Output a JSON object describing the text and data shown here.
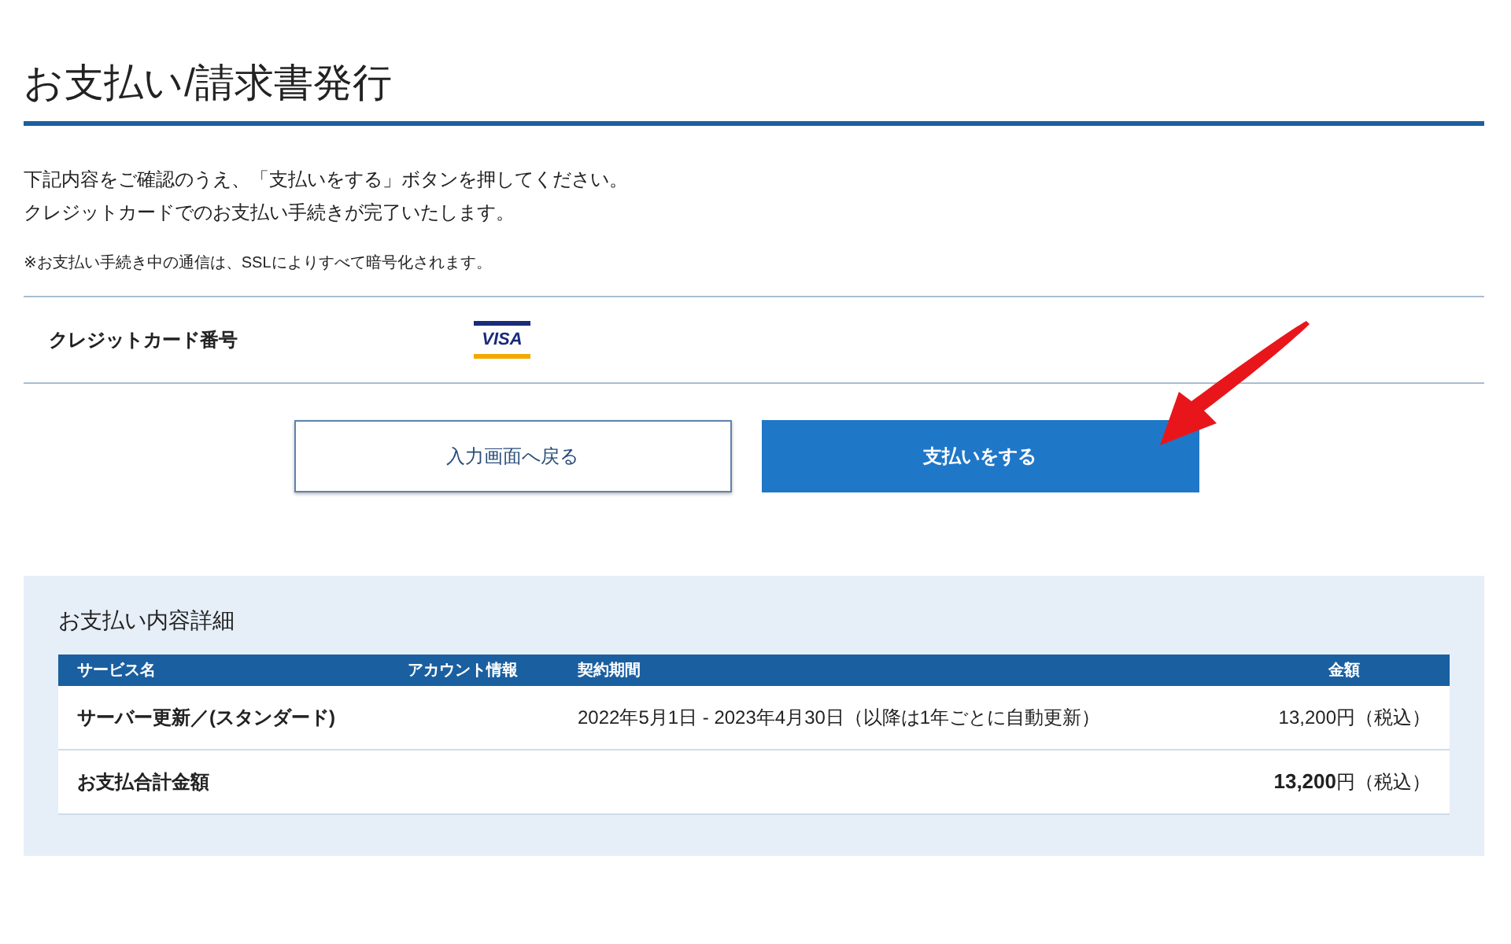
{
  "page_title": "お支払い/請求書発行",
  "instructions": [
    "下記内容をご確認のうえ、「支払いをする」ボタンを押してください。",
    "クレジットカードでのお支払い手続きが完了いたします。"
  ],
  "note": "※お支払い手続き中の通信は、SSLによりすべて暗号化されます。",
  "card_field": {
    "label": "クレジットカード番号",
    "brand": "VISA"
  },
  "buttons": [
    {
      "label": "入力画面へ戻る",
      "kind": "secondary"
    },
    {
      "label": "支払いをする",
      "kind": "primary"
    }
  ],
  "details": {
    "title": "お支払い内容詳細",
    "columns": [
      "サービス名",
      "アカウント情報",
      "契約期間",
      "金額"
    ],
    "rows": [
      [
        "サーバー更新／(スタンダード)",
        "",
        "2022年5月1日 - 2023年4月30日（以降は1年ごとに自動更新）",
        "13,200円（税込）"
      ]
    ],
    "total": {
      "label": "お支払合計金額",
      "amount": "**13,200**円（税込）"
    }
  }
}
